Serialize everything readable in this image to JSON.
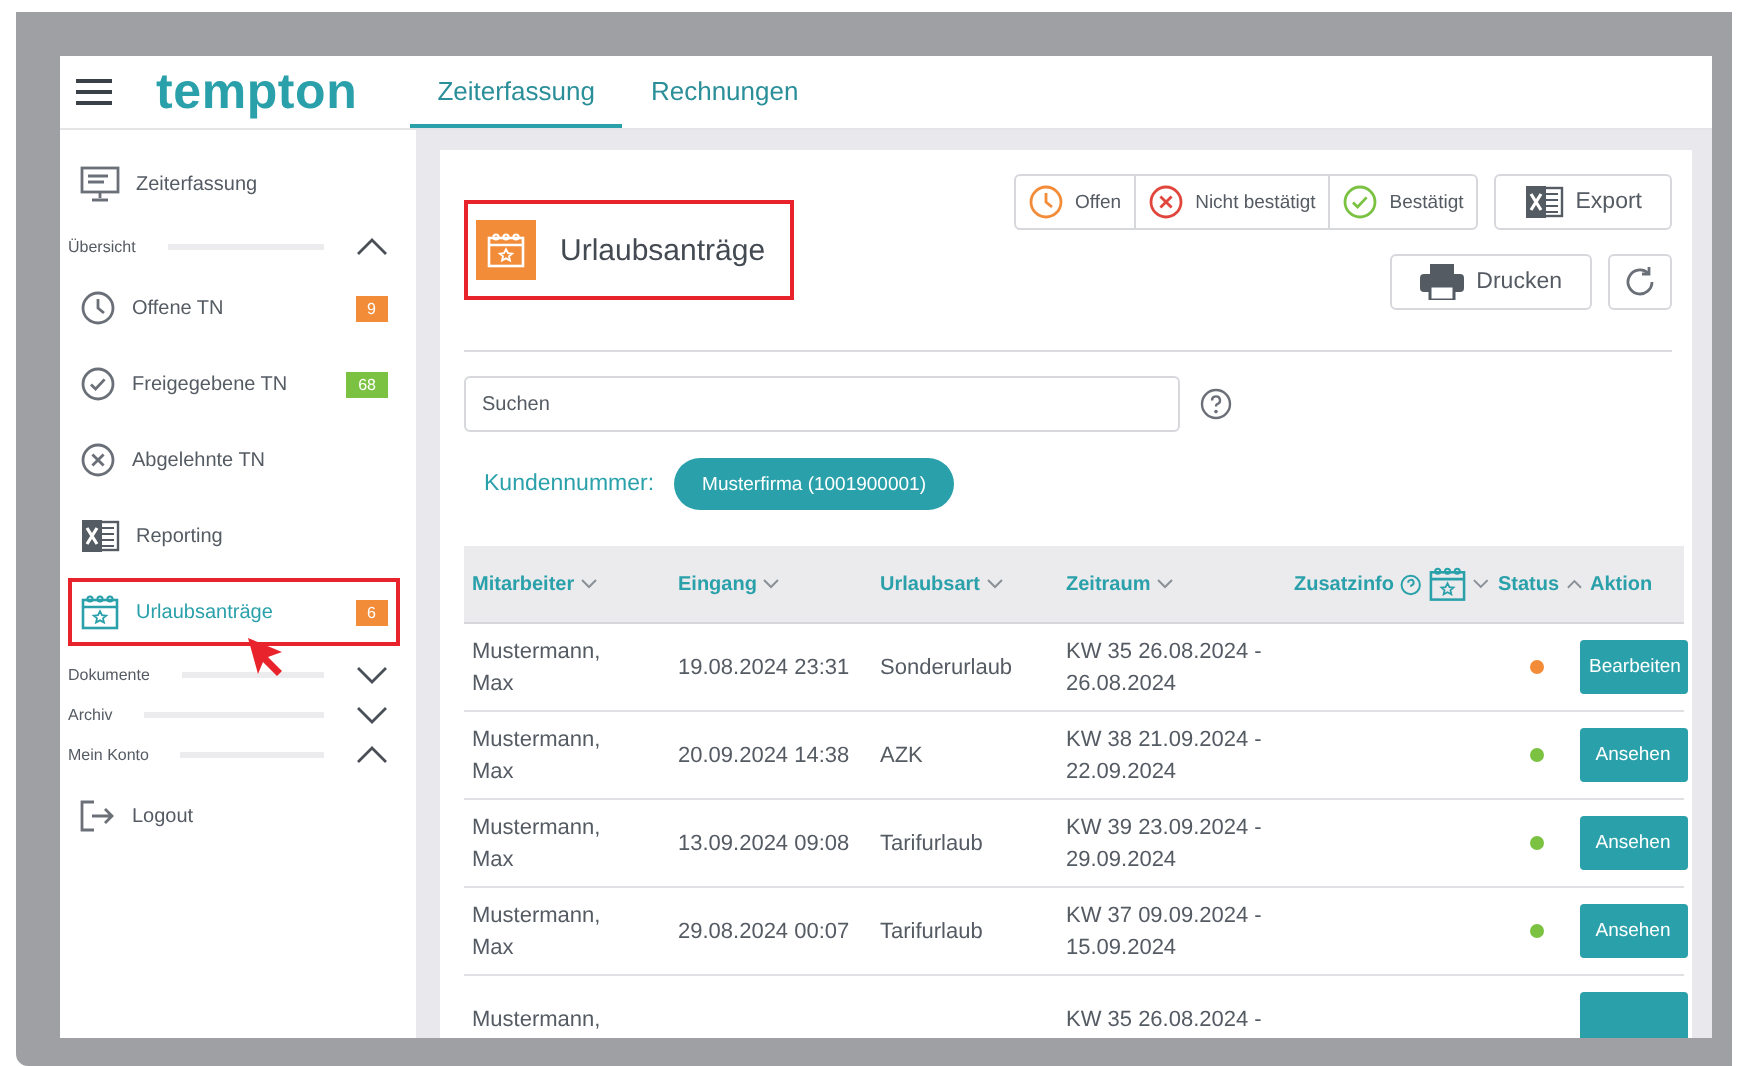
{
  "header": {
    "logo": "tempton",
    "tabs": [
      {
        "label": "Zeiterfassung",
        "selected": true
      },
      {
        "label": "Rechnungen",
        "selected": false
      }
    ]
  },
  "sidebar": {
    "items": [
      {
        "kind": "link",
        "label": "Zeiterfassung",
        "selected": false,
        "highlighted": false
      },
      {
        "kind": "section",
        "label": "Übersicht",
        "expanded": true
      },
      {
        "kind": "link",
        "label": "Offene TN",
        "badge": "9",
        "color": "#f28c38",
        "selected": false,
        "highlighted": false
      },
      {
        "kind": "link",
        "label": "Freigegebene TN",
        "badge": "68",
        "color": "#7cc242",
        "selected": false,
        "highlighted": false
      },
      {
        "kind": "link",
        "label": "Abgelehnte TN",
        "selected": false,
        "highlighted": false
      },
      {
        "kind": "link",
        "label": "Reporting",
        "selected": false,
        "highlighted": false
      },
      {
        "kind": "link",
        "label": "Urlaubsanträge",
        "badge": "6",
        "color": "#f28c38",
        "selected": true,
        "highlighted": true
      },
      {
        "kind": "section",
        "label": "Dokumente",
        "expanded": false
      },
      {
        "kind": "section",
        "label": "Archiv",
        "expanded": false
      },
      {
        "kind": "section",
        "label": "Mein Konto",
        "expanded": true
      },
      {
        "kind": "link",
        "label": "Logout",
        "selected": false,
        "highlighted": false
      }
    ]
  },
  "page": {
    "title": "Urlaubsanträge",
    "highlighted": true,
    "legend": [
      {
        "label": "Offen",
        "color": "#f28c38"
      },
      {
        "label": "Nicht bestätigt",
        "color": "#e0463c"
      },
      {
        "label": "Bestätigt",
        "color": "#7cc242"
      }
    ],
    "buttons": [
      {
        "kind": "export",
        "label": "Export"
      },
      {
        "kind": "print",
        "label": "Drucken"
      },
      {
        "kind": "refresh"
      }
    ],
    "search": {
      "placeholder": "Suchen"
    },
    "customer": {
      "label": "Kundennummer:",
      "chip": "Musterfirma (1001900001)"
    }
  },
  "table": {
    "columns": [
      {
        "label": "Mitarbeiter",
        "ascending": false
      },
      {
        "label": "Eingang",
        "ascending": false
      },
      {
        "label": "Urlaubsart",
        "ascending": false
      },
      {
        "label": "Zeitraum",
        "ascending": false
      },
      {
        "label": "Zusatzinfo",
        "ascending": false,
        "kind": "info"
      },
      {
        "label": "Status",
        "ascending": true
      },
      {
        "label": "Aktion"
      }
    ],
    "rows": [
      {
        "employee": "Mustermann, Max",
        "received": "19.08.2024 23:31",
        "type": "Sonderurlaub",
        "period": "KW 35 26.08.2024 - 26.08.2024",
        "color": "#f28c38",
        "action": "Bearbeiten"
      },
      {
        "employee": "Mustermann, Max",
        "received": "20.09.2024 14:38",
        "type": "AZK",
        "period": "KW 38 21.09.2024 - 22.09.2024",
        "color": "#7cc242",
        "action": "Ansehen"
      },
      {
        "employee": "Mustermann, Max",
        "received": "13.09.2024 09:08",
        "type": "Tarifurlaub",
        "period": "KW 39 23.09.2024 - 29.09.2024",
        "color": "#7cc242",
        "action": "Ansehen"
      },
      {
        "employee": "Mustermann, Max",
        "received": "29.08.2024 00:07",
        "type": "Tarifurlaub",
        "period": "KW 37 09.09.2024 - 15.09.2024",
        "color": "#7cc242",
        "action": "Ansehen"
      },
      {
        "employee": "Mustermann,",
        "period": "KW 35 26.08.2024 -"
      }
    ]
  }
}
